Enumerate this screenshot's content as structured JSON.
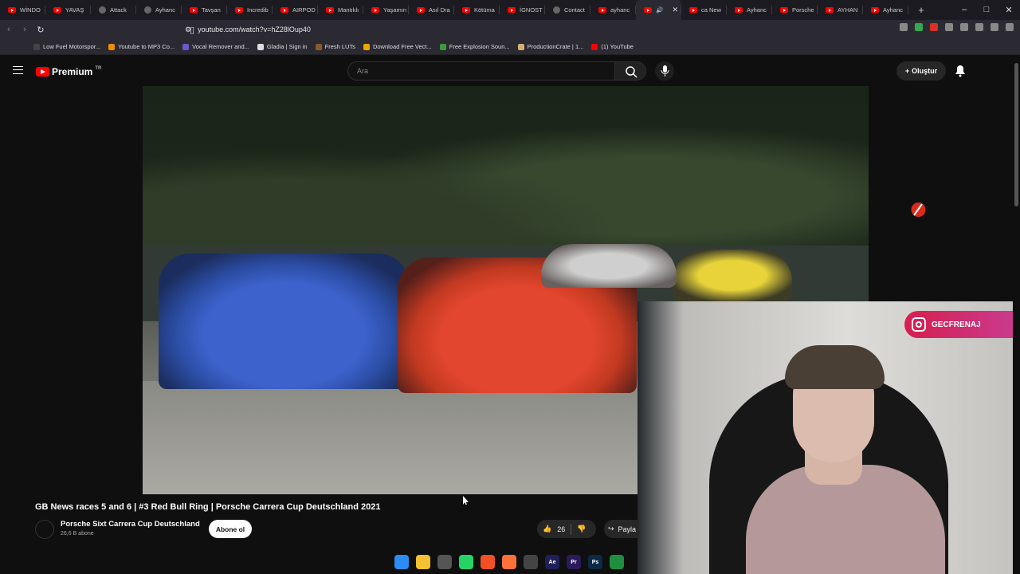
{
  "browser": {
    "tabs": [
      {
        "title": "WİNDO",
        "icon": "youtube"
      },
      {
        "title": "YAVAŞ",
        "icon": "youtube"
      },
      {
        "title": "Attack",
        "icon": "generic"
      },
      {
        "title": "Ayhanc",
        "icon": "generic"
      },
      {
        "title": "Tavşan",
        "icon": "youtube"
      },
      {
        "title": "Incredib",
        "icon": "youtube"
      },
      {
        "title": "AIRPOD",
        "icon": "youtube"
      },
      {
        "title": "Mantıklı",
        "icon": "youtube"
      },
      {
        "title": "Yaşamın",
        "icon": "youtube"
      },
      {
        "title": "Asıl Dra",
        "icon": "youtube"
      },
      {
        "title": "Kötüma",
        "icon": "youtube"
      },
      {
        "title": "İGNOST",
        "icon": "youtube"
      },
      {
        "title": "Contact",
        "icon": "generic"
      },
      {
        "title": "ayhanc",
        "icon": "youtube"
      },
      {
        "title": "",
        "icon": "youtube"
      },
      {
        "title": "ca New",
        "icon": "youtube"
      },
      {
        "title": "Ayhanc",
        "icon": "youtube"
      },
      {
        "title": "Porsche",
        "icon": "youtube"
      },
      {
        "title": "AYHAN",
        "icon": "youtube"
      },
      {
        "title": "Ayhanc",
        "icon": "youtube"
      }
    ],
    "url": "youtube.com/watch?v=hZ28lOup40",
    "bookmarks": [
      {
        "label": "Low Fuel Motorspor...",
        "color": "#444444"
      },
      {
        "label": "Youtube to MP3 Co...",
        "color": "#f28b00"
      },
      {
        "label": "Vocal Remover and...",
        "color": "#6a5acd"
      },
      {
        "label": "Gladia | Sign in",
        "color": "#dddddd"
      },
      {
        "label": "Fresh LUTs",
        "color": "#8b5a2b"
      },
      {
        "label": "Download Free Vect...",
        "color": "#f2a400"
      },
      {
        "label": "Free Explosion Soun...",
        "color": "#3c9a3c"
      },
      {
        "label": "ProductionCrate | 1...",
        "color": "#d4b070"
      },
      {
        "label": "(1) YouTube",
        "color": "#ff0000"
      }
    ]
  },
  "youtube": {
    "logo_text": "Premium",
    "region": "TR",
    "search_placeholder": "Ara",
    "create_label": "Oluştur"
  },
  "overlay": {
    "instagram_handle": "GECFRENAJ"
  },
  "video": {
    "title": "GB News races 5 and 6 | #3 Red Bull Ring | Porsche Carrera Cup Deutschland 2021",
    "channel": "Porsche Sixt Carrera Cup Deutschland",
    "subscribers": "26,6 B abone",
    "subscribe_label": "Abone ol",
    "likes": "26",
    "share_label": "Payla"
  },
  "taskbar": {
    "apps": [
      {
        "name": "windows",
        "label": "",
        "color": "#2b8cf3"
      },
      {
        "name": "files",
        "label": "",
        "color": "#f4c034"
      },
      {
        "name": "capture",
        "label": "",
        "color": "#555555"
      },
      {
        "name": "whatsapp",
        "label": "",
        "color": "#25d366"
      },
      {
        "name": "brave",
        "label": "",
        "color": "#f25022"
      },
      {
        "name": "firefox",
        "label": "",
        "color": "#ff7139"
      },
      {
        "name": "chatgpt",
        "label": "",
        "color": "#444444"
      },
      {
        "name": "after-effects",
        "label": "Ae",
        "color": "#1f1f5a"
      },
      {
        "name": "premiere",
        "label": "Pr",
        "color": "#2b1a5a"
      },
      {
        "name": "photoshop",
        "label": "Ps",
        "color": "#0b2a45"
      },
      {
        "name": "arrow",
        "label": "",
        "color": "#1f8f3f"
      }
    ]
  }
}
